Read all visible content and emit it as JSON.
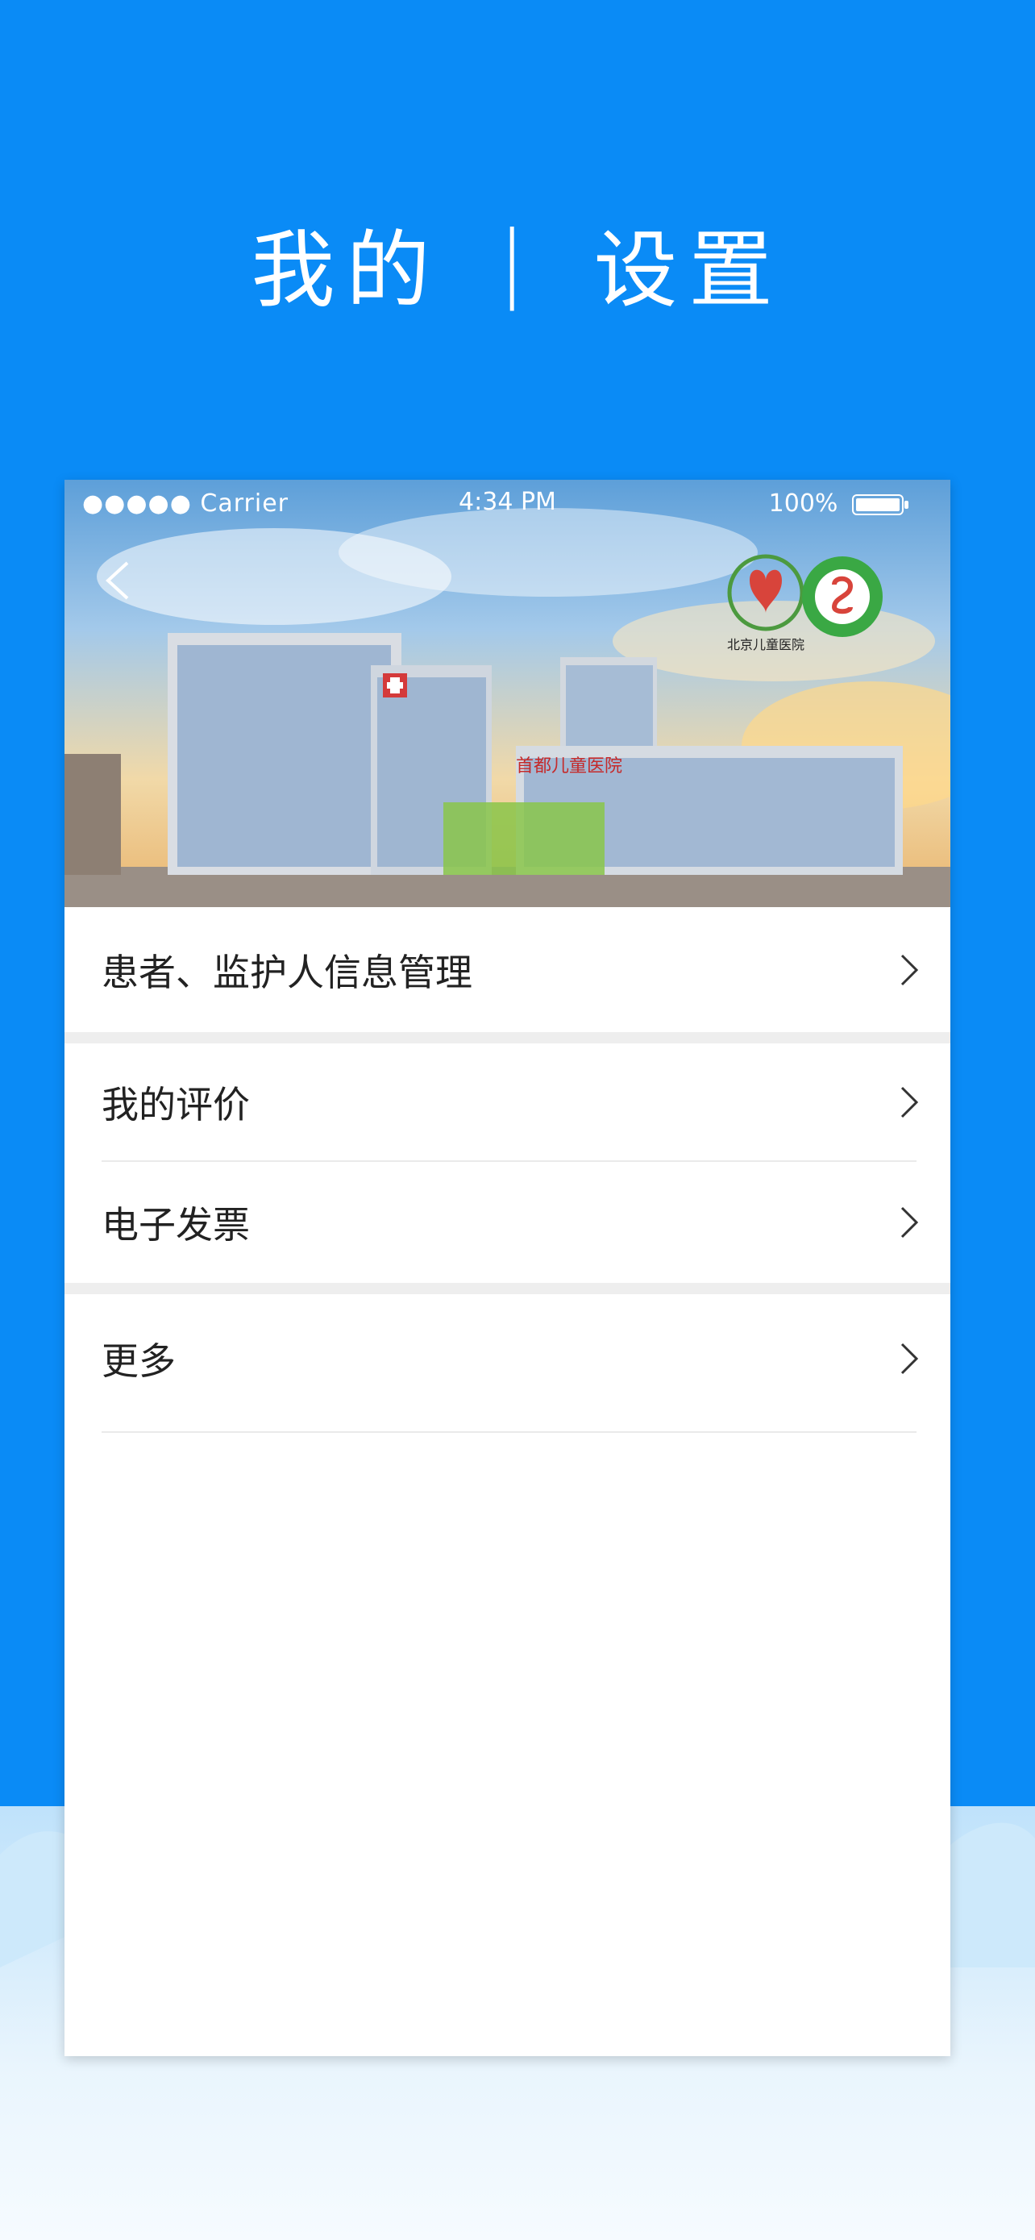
{
  "promo": {
    "left": "我的",
    "separator": "|",
    "right": "设置"
  },
  "status_bar": {
    "signal": "●●●●● Carrier",
    "time": "4:34 PM",
    "battery": "100%"
  },
  "banner": {
    "building_sign": "首都儿童医院",
    "logo_text": "北京儿童医院"
  },
  "menu": [
    {
      "label": "患者、监护人信息管理"
    },
    {
      "label": "我的评价"
    },
    {
      "label": "电子发票"
    },
    {
      "label": "更多"
    }
  ],
  "icons": {
    "back": "chevron-left-icon",
    "chevron": "chevron-right-icon",
    "wifi": "wifi-icon",
    "battery": "battery-icon"
  },
  "colors": {
    "background": "#0a8bf6",
    "text": "#222222",
    "white": "#ffffff"
  }
}
